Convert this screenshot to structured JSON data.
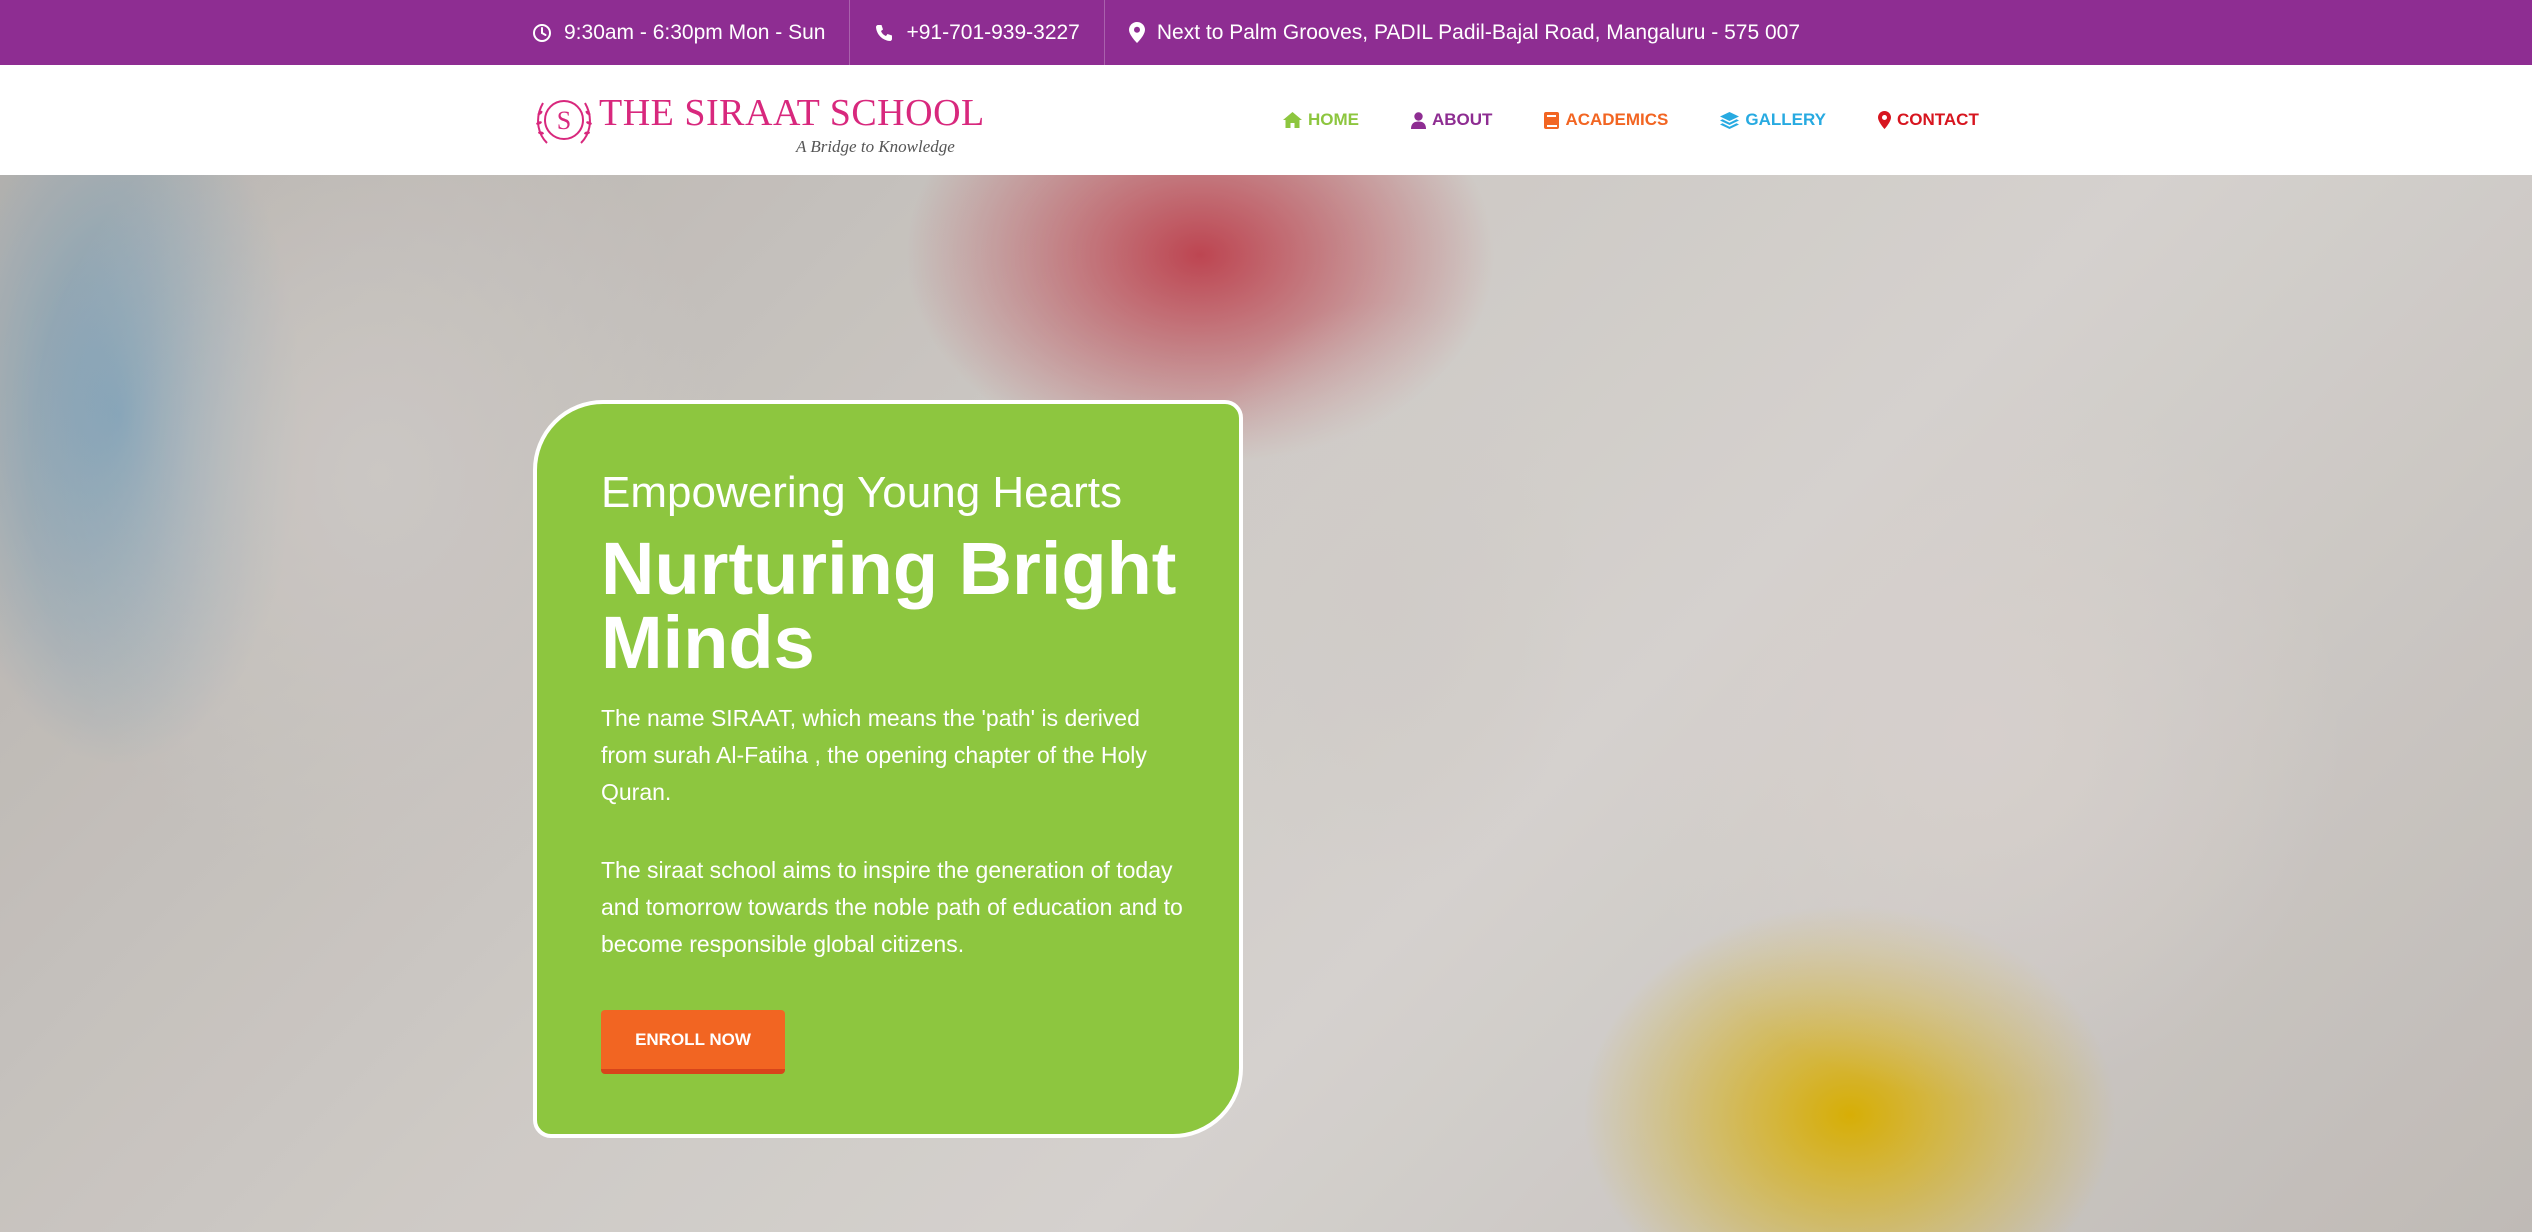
{
  "topbar": {
    "hours": "9:30am - 6:30pm Mon - Sun",
    "phone": "+91-701-939-3227",
    "address": "Next to Palm Grooves, PADIL Padil-Bajal Road, Mangaluru - 575 007",
    "background_color": "#8e2d92",
    "icons": [
      "clock-icon",
      "phone-icon",
      "map-pin-icon"
    ]
  },
  "logo": {
    "title": "THE SIRAAT SCHOOL",
    "tagline": "A Bridge to Knowledge",
    "emblem_letter": "S",
    "color": "#d8287d"
  },
  "nav": {
    "items": [
      {
        "label": "HOME",
        "icon": "home-icon",
        "color": "#8dc63f"
      },
      {
        "label": "ABOUT",
        "icon": "user-icon",
        "color": "#8e2d92"
      },
      {
        "label": "ACADEMICS",
        "icon": "book-icon",
        "color": "#f26522"
      },
      {
        "label": "GALLERY",
        "icon": "layers-icon",
        "color": "#27aae1"
      },
      {
        "label": "CONTACT",
        "icon": "map-marker-icon",
        "color": "#d7151f"
      }
    ]
  },
  "hero": {
    "pretitle": "Empowering Young Hearts",
    "title": "Nurturing Bright Minds",
    "paragraph1": "The name SIRAAT, which means the 'path' is derived from surah Al-Fatiha , the opening chapter of the Holy Quran.",
    "paragraph2": "The siraat school aims to inspire the generation of today and tomorrow towards the noble path of education and to become responsible global citizens.",
    "cta_label": "ENROLL NOW",
    "card_color": "#8dc63f",
    "cta_color": "#f26522"
  }
}
